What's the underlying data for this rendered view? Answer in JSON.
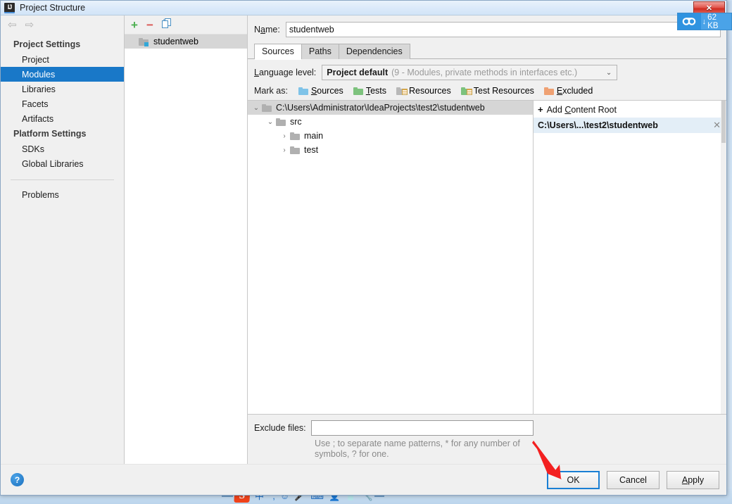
{
  "window": {
    "title": "Project Structure",
    "icon": "intellij-idea-logo-icon",
    "close_label": "✕"
  },
  "cloud_widget": {
    "icon": "cloud-icon",
    "download_icon": "↓",
    "amount": "62 KB"
  },
  "navigation": {
    "back_icon": "⇦",
    "forward_icon": "⇨"
  },
  "sidebar": {
    "groups": [
      {
        "title": "Project Settings",
        "items": [
          {
            "label": "Project",
            "selected": false
          },
          {
            "label": "Modules",
            "selected": true
          },
          {
            "label": "Libraries",
            "selected": false
          },
          {
            "label": "Facets",
            "selected": false
          },
          {
            "label": "Artifacts",
            "selected": false
          }
        ]
      },
      {
        "title": "Platform Settings",
        "items": [
          {
            "label": "SDKs",
            "selected": false
          },
          {
            "label": "Global Libraries",
            "selected": false
          }
        ]
      }
    ],
    "problems_label": "Problems"
  },
  "modules_panel": {
    "toolbar": {
      "add_icon": "+",
      "remove_icon": "−",
      "copy_icon": "copy-icon"
    },
    "items": [
      {
        "label": "studentweb",
        "icon": "module-folder-icon",
        "selected": true
      }
    ]
  },
  "main": {
    "name_label": "Name:",
    "name_value": "studentweb",
    "tabs": [
      {
        "label": "Sources",
        "active": true
      },
      {
        "label": "Paths",
        "active": false
      },
      {
        "label": "Dependencies",
        "active": false
      }
    ],
    "language_level": {
      "label": "Language level:",
      "value_bold": "Project default",
      "value_desc": "(9 - Modules, private methods in interfaces etc.)",
      "chevron": "⌄"
    },
    "mark_as": {
      "label": "Mark as:",
      "options": [
        {
          "label": "Sources",
          "color": "#7fc3e8",
          "icon": "folder-blue-icon"
        },
        {
          "label": "Tests",
          "color": "#7dc27d",
          "icon": "folder-green-icon"
        },
        {
          "label": "Resources",
          "color": "#b8b8b8",
          "icon": "folder-gray-lines-icon"
        },
        {
          "label": "Test Resources",
          "color": "#7dc27d",
          "icon": "folder-green-lines-icon"
        },
        {
          "label": "Excluded",
          "color": "#efa173",
          "icon": "folder-orange-icon"
        }
      ]
    },
    "tree": [
      {
        "label": "C:\\Users\\Administrator\\IdeaProjects\\test2\\studentweb",
        "depth": 0,
        "twisty": "⌄",
        "selected": true
      },
      {
        "label": "src",
        "depth": 1,
        "twisty": "⌄",
        "selected": false
      },
      {
        "label": "main",
        "depth": 2,
        "twisty": "›",
        "selected": false
      },
      {
        "label": "test",
        "depth": 2,
        "twisty": "›",
        "selected": false
      }
    ],
    "content_roots": {
      "add_label": "Add Content Root",
      "add_icon": "+",
      "items": [
        {
          "label": "C:\\Users\\...\\test2\\studentweb",
          "close_icon": "✕",
          "selected": true
        }
      ]
    },
    "exclude": {
      "label": "Exclude files:",
      "value": "",
      "hint": "Use ; to separate name patterns, * for any number of symbols, ? for one."
    }
  },
  "footer": {
    "help_icon": "?",
    "buttons": [
      {
        "label": "OK",
        "focused": true
      },
      {
        "label": "Cancel",
        "focused": false
      },
      {
        "label": "Apply",
        "focused": false
      }
    ]
  },
  "ime_tray": {
    "logo": "S",
    "icons": [
      "中",
      "°,",
      "☺",
      "🎤",
      "⌨",
      "👤",
      "👕",
      "🔧"
    ]
  }
}
